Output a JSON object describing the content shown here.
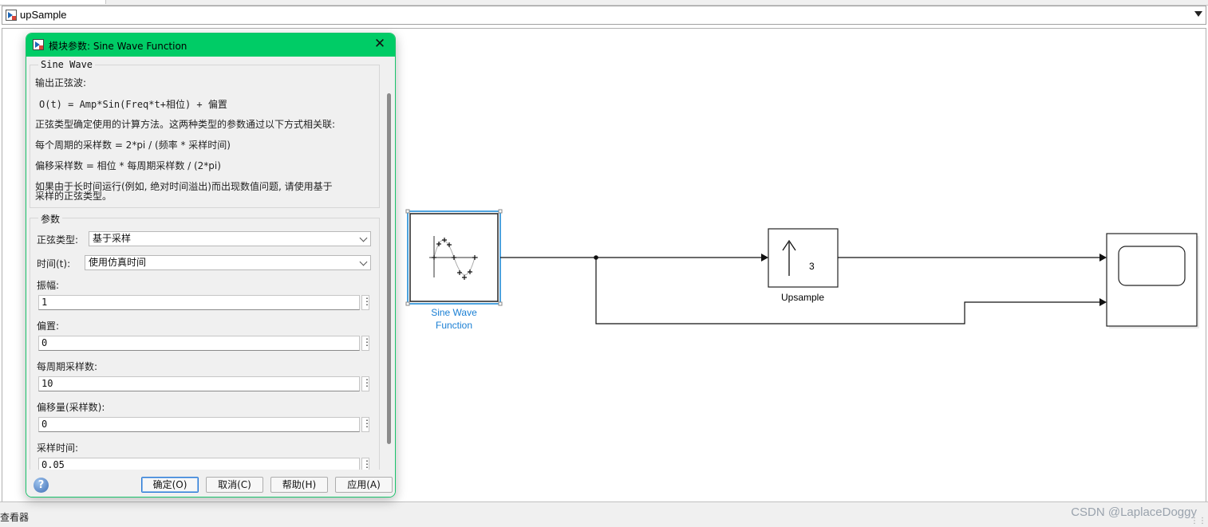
{
  "model": {
    "name": "upSample"
  },
  "status": {
    "left": "查看器",
    "watermark": "CSDN @LaplaceDoggy",
    "grip": "⋮⋮"
  },
  "dialog": {
    "title": "模块参数: Sine Wave Function",
    "close_glyph": "✕",
    "desc_group": "Sine Wave",
    "desc": {
      "line1": "输出正弦波:",
      "line2": "O(t) = Amp*Sin(Freq*t+相位) + 偏置",
      "line3": "正弦类型确定使用的计算方法。这两种类型的参数通过以下方式相关联:",
      "line4": "每个周期的采样数 = 2*pi / (频率 * 采样时间)",
      "line5": "偏移采样数 = 相位 * 每周期采样数 / (2*pi)",
      "line6a": "如果由于长时间运行(例如, 绝对时间溢出)而出现数值问题, 请使用基于",
      "line6b": "采样的正弦类型。"
    },
    "params_group": "参数",
    "params": {
      "sine_type_label": "正弦类型:",
      "sine_type_value": "基于采样",
      "time_label": "时间(t):",
      "time_value": "使用仿真时间",
      "amp_label": "振幅:",
      "amp_value": "1",
      "bias_label": "偏置:",
      "bias_value": "0",
      "spp_label": "每周期采样数:",
      "spp_value": "10",
      "offset_label": "偏移量(采样数):",
      "offset_value": "0",
      "ts_label": "采样时间:",
      "ts_value": "0.05"
    },
    "kebab": "⋮",
    "help": "?",
    "buttons": {
      "ok": "确定(O)",
      "cancel": "取消(C)",
      "help": "帮助(H)",
      "apply": "应用(A)"
    }
  },
  "blocks": {
    "sine": {
      "label_line1": "Sine Wave",
      "label_line2": "Function"
    },
    "upsample": {
      "factor": "3",
      "label": "Upsample"
    }
  },
  "colors": {
    "dialog_titlebar": "#00cc66",
    "selected_block": "#4da3df",
    "block_label_link": "#1a7fd4"
  }
}
